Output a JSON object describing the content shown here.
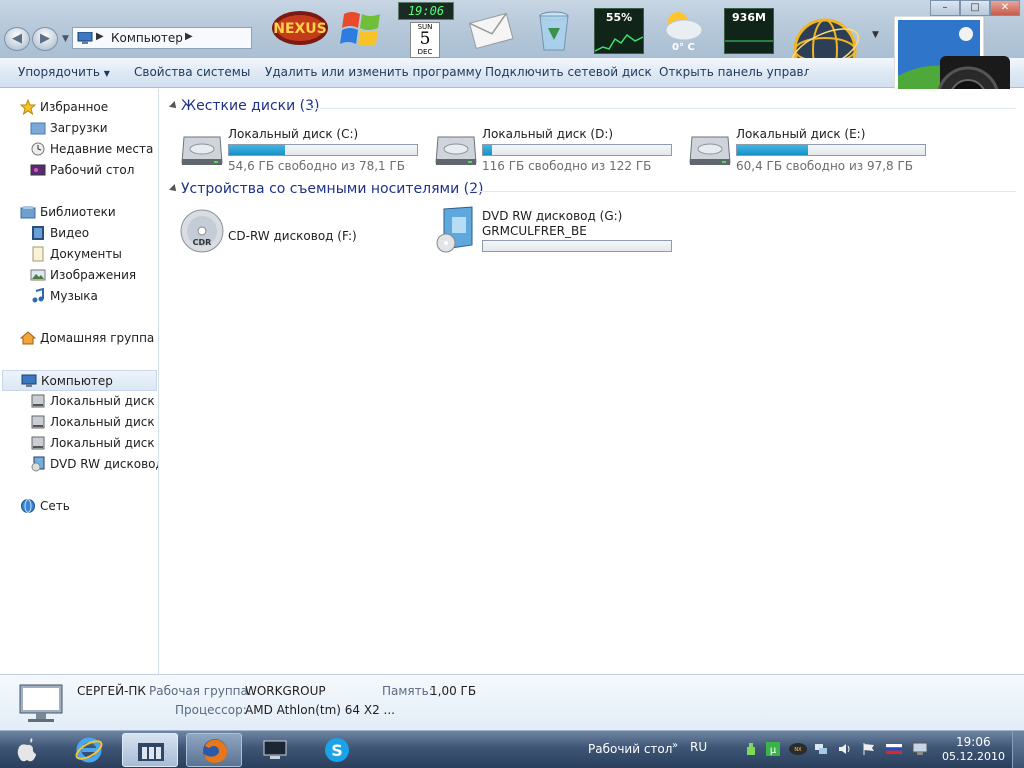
{
  "window": {
    "address_segment": "Компьютер",
    "controls": {
      "minimize": "–",
      "maximize": "□",
      "close": "✕"
    }
  },
  "dock": {
    "nexus_label": "NEXUS",
    "clock": "19:06",
    "calendar": {
      "dow": "SUN",
      "day": "5",
      "month": "DEC"
    },
    "cpu_percent": "55%",
    "weather_temp": "0° C",
    "ram": "936M"
  },
  "toolbar": {
    "organize": "Упорядочить",
    "system_properties": "Свойства системы",
    "uninstall": "Удалить или изменить программу",
    "map_drive": "Подключить сетевой диск",
    "control_panel": "Открыть панель управления"
  },
  "nav": {
    "favorites": "Избранное",
    "downloads": "Загрузки",
    "recent": "Недавние места",
    "desktop": "Рабочий стол",
    "libraries": "Библиотеки",
    "video": "Видео",
    "documents": "Документы",
    "pictures": "Изображения",
    "music": "Музыка",
    "homegroup": "Домашняя группа",
    "computer": "Компьютер",
    "drive_c": "Локальный диск (C:)",
    "drive_d": "Локальный диск (D:)",
    "drive_e": "Локальный диск (E:)",
    "drive_g": "DVD RW дисковод (G:)",
    "network": "Сеть"
  },
  "content": {
    "hard_disks_header": "Жесткие диски (3)",
    "removable_header": "Устройства со съемными носителями (2)",
    "drives": [
      {
        "name": "Локальный диск (C:)",
        "free": "54,6 ГБ свободно из 78,1 ГБ",
        "used_fraction": 0.3
      },
      {
        "name": "Локальный диск (D:)",
        "free": "116 ГБ свободно из 122 ГБ",
        "used_fraction": 0.05
      },
      {
        "name": "Локальный диск (E:)",
        "free": "60,4 ГБ свободно из 97,8 ГБ",
        "used_fraction": 0.38
      }
    ],
    "removable": [
      {
        "name": "CD-RW дисковод (F:)",
        "icon_text": "CDR"
      },
      {
        "name": "DVD RW дисковод (G:)",
        "label": "GRMCULFRER_BE"
      }
    ]
  },
  "details": {
    "computer_name": "СЕРГЕЙ-ПК",
    "workgroup_label": "Рабочая группа:",
    "workgroup_value": "WORKGROUP",
    "memory_label": "Память:",
    "memory_value": "1,00 ГБ",
    "cpu_label": "Процессор:",
    "cpu_value": "AMD Athlon(tm) 64 X2 ..."
  },
  "taskbar": {
    "desktop_toolbar": "Рабочий стол",
    "lang": "RU",
    "time": "19:06",
    "date": "05.12.2010"
  }
}
